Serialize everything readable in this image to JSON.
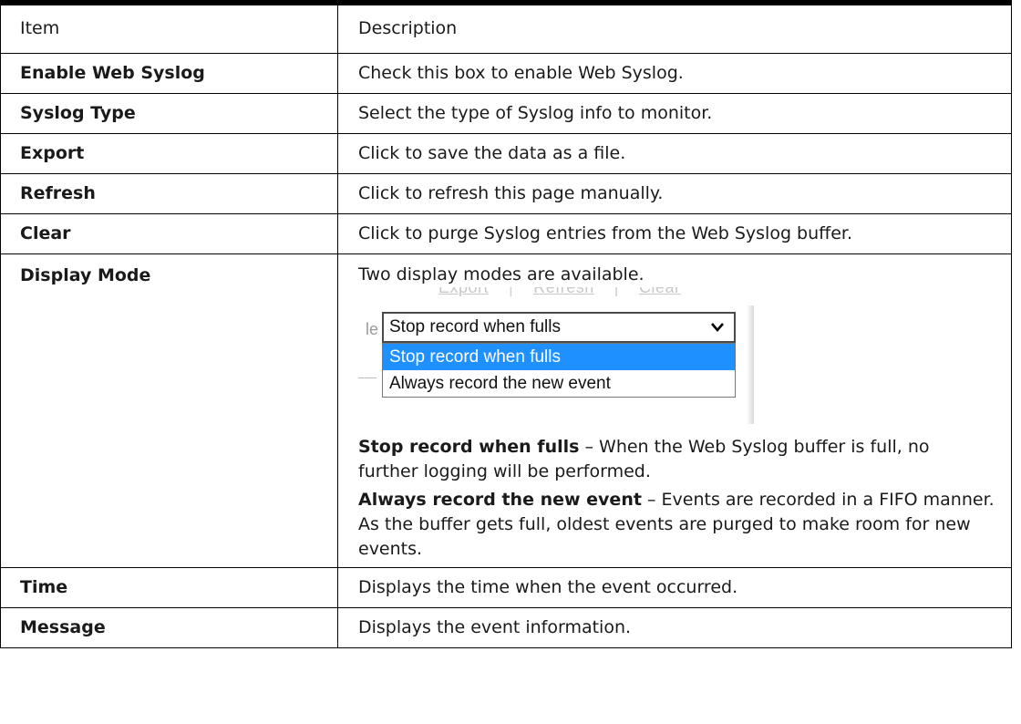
{
  "table": {
    "headers": {
      "item": "Item",
      "description": "Description"
    },
    "rows": [
      {
        "item": "Enable Web Syslog",
        "description": "Check this box to enable Web Syslog."
      },
      {
        "item": "Syslog Type",
        "description": "Select the type of Syslog info to monitor."
      },
      {
        "item": "Export",
        "description": "Click to save the data as a file."
      },
      {
        "item": "Refresh",
        "description": "Click to refresh this page manually."
      },
      {
        "item": "Clear",
        "description": "Click to purge Syslog entries from the Web Syslog buffer."
      },
      {
        "item": "Display Mode",
        "intro": "Two display modes are available.",
        "screenshot": {
          "background_links": [
            "Export",
            "Refresh",
            "Clear"
          ],
          "background_label": "le",
          "select_value": "Stop record when fulls",
          "options": [
            "Stop record when fulls",
            "Always record the new event"
          ],
          "highlighted_option": "Stop record when fulls"
        },
        "modes": [
          {
            "term": "Stop record when fulls",
            "separator": " – ",
            "text": "When the Web Syslog buffer is full, no further logging will be performed."
          },
          {
            "term": "Always record the new event",
            "separator": " – ",
            "text": "Events are recorded in a FIFO manner. As the buffer gets full, oldest events are purged to make room for new events."
          }
        ]
      },
      {
        "item": "Time",
        "description": "Displays the time when the event occurred."
      },
      {
        "item": "Message",
        "description": "Displays the event information."
      }
    ]
  },
  "colors": {
    "border": "#000000",
    "highlight": "#1e90ff",
    "text": "#1a1a1a"
  }
}
